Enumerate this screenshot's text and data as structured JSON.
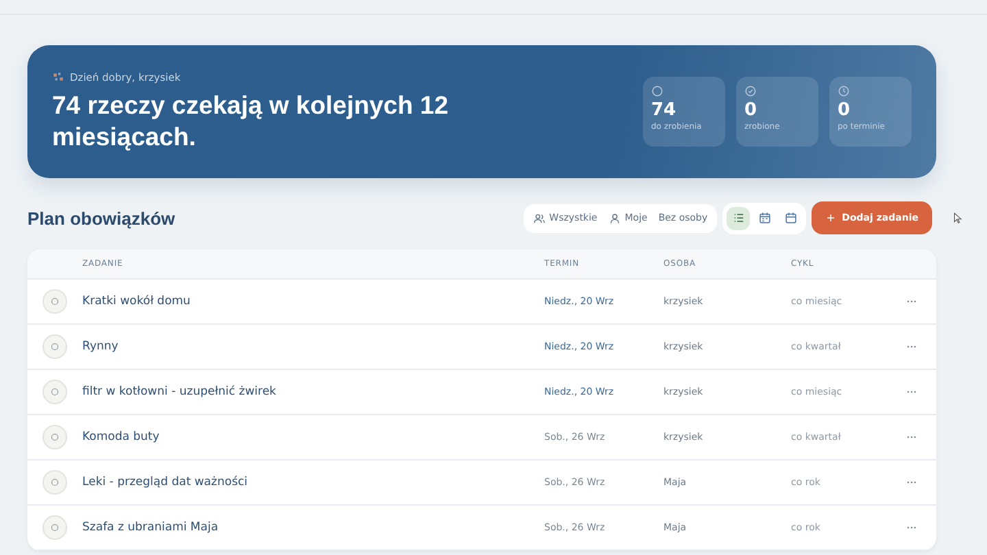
{
  "hero": {
    "greeting": "Dzień dobry, krzysiek",
    "headline": "74 rzeczy czekają w kolejnych 12 miesiącach.",
    "stats": [
      {
        "kind": "todo",
        "value": "74",
        "label": "do zrobienia"
      },
      {
        "kind": "done",
        "value": "0",
        "label": "zrobione"
      },
      {
        "kind": "overdue",
        "value": "0",
        "label": "po terminie"
      }
    ]
  },
  "section": {
    "title": "Plan obowiązków",
    "filters": [
      {
        "kind": "people",
        "label": "Wszystkie"
      },
      {
        "kind": "person",
        "label": "Moje"
      },
      {
        "kind": "none",
        "label": "Bez osoby"
      }
    ],
    "views": [
      {
        "kind": "list",
        "selected": true
      },
      {
        "kind": "calendar",
        "selected": false
      },
      {
        "kind": "month",
        "selected": false
      }
    ],
    "add_button": "Dodaj zadanie"
  },
  "table": {
    "columns": [
      "ZADANIE",
      "TERMIN",
      "OSOBA",
      "CYKL"
    ],
    "rows": [
      {
        "task": "Kratki wokół domu",
        "date": "Niedz., 20 Wrz",
        "soon": true,
        "person": "krzysiek",
        "cycle": "co miesiąc",
        "checked": false
      },
      {
        "task": "Rynny",
        "date": "Niedz., 20 Wrz",
        "soon": true,
        "person": "krzysiek",
        "cycle": "co kwartał",
        "checked": false
      },
      {
        "task": "filtr w kotłowni - uzupełnić żwirek",
        "date": "Niedz., 20 Wrz",
        "soon": true,
        "person": "krzysiek",
        "cycle": "co miesiąc",
        "checked": false
      },
      {
        "task": "Komoda buty",
        "date": "Sob., 26 Wrz",
        "soon": false,
        "person": "krzysiek",
        "cycle": "co kwartał",
        "checked": false
      },
      {
        "task": "Leki - przegląd dat ważności",
        "date": "Sob., 26 Wrz",
        "soon": false,
        "person": "Maja",
        "cycle": "co rok",
        "checked": false
      },
      {
        "task": "Szafa z ubraniami Maja",
        "date": "Sob., 26 Wrz",
        "soon": false,
        "person": "Maja",
        "cycle": "co rok",
        "checked": false
      }
    ]
  }
}
